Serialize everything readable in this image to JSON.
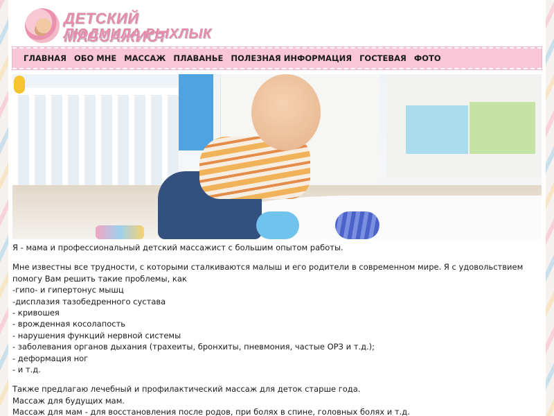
{
  "header": {
    "logo_line1": "ДЕТСКИЙ МАССАЖИСТ",
    "logo_line2": "ЛЮДМИЛА РЫХЛЫК"
  },
  "nav": {
    "items": [
      {
        "label": "ГЛАВНАЯ"
      },
      {
        "label": "ОБО МНЕ"
      },
      {
        "label": "МАССАЖ"
      },
      {
        "label": "ПЛАВАНЬЕ"
      },
      {
        "label": "ПОЛЕЗНАЯ ИНФОРМАЦИЯ"
      },
      {
        "label": "ГОСТЕВАЯ"
      },
      {
        "label": "ФОТО"
      }
    ]
  },
  "colors": {
    "nav_bg": "#f8c6d6",
    "logo_text": "#e58bab",
    "text": "#1a1a1a"
  },
  "content": {
    "intro": "Я - мама и профессиональный детский массажист с большим опытом работы.",
    "paragraph": "Мне известны все трудности, с которыми сталкиваются малыш и его родители в современном мире. Я с удовольствием помогу Вам решить такие проблемы, как",
    "problems": [
      "-гипо- и гипертонус мышц",
      "-дисплазия тазобедренного сустава",
      "- кривошея",
      "- врожденная косолапость",
      "- нарушения функций нервной системы",
      "- заболевания органов дыхания (трахеиты, бронхиты, пневмония, частые ОРЗ и т.д.);",
      "- деформация ног",
      "- и т.д."
    ],
    "extra": [
      "Также предлагаю лечебный и профилактический массаж для деток старше года.",
      "Массаж для будущих мам.",
      "Массаж для мам - для восстановления после родов, при болях в спине, головных болях и т.д."
    ]
  }
}
